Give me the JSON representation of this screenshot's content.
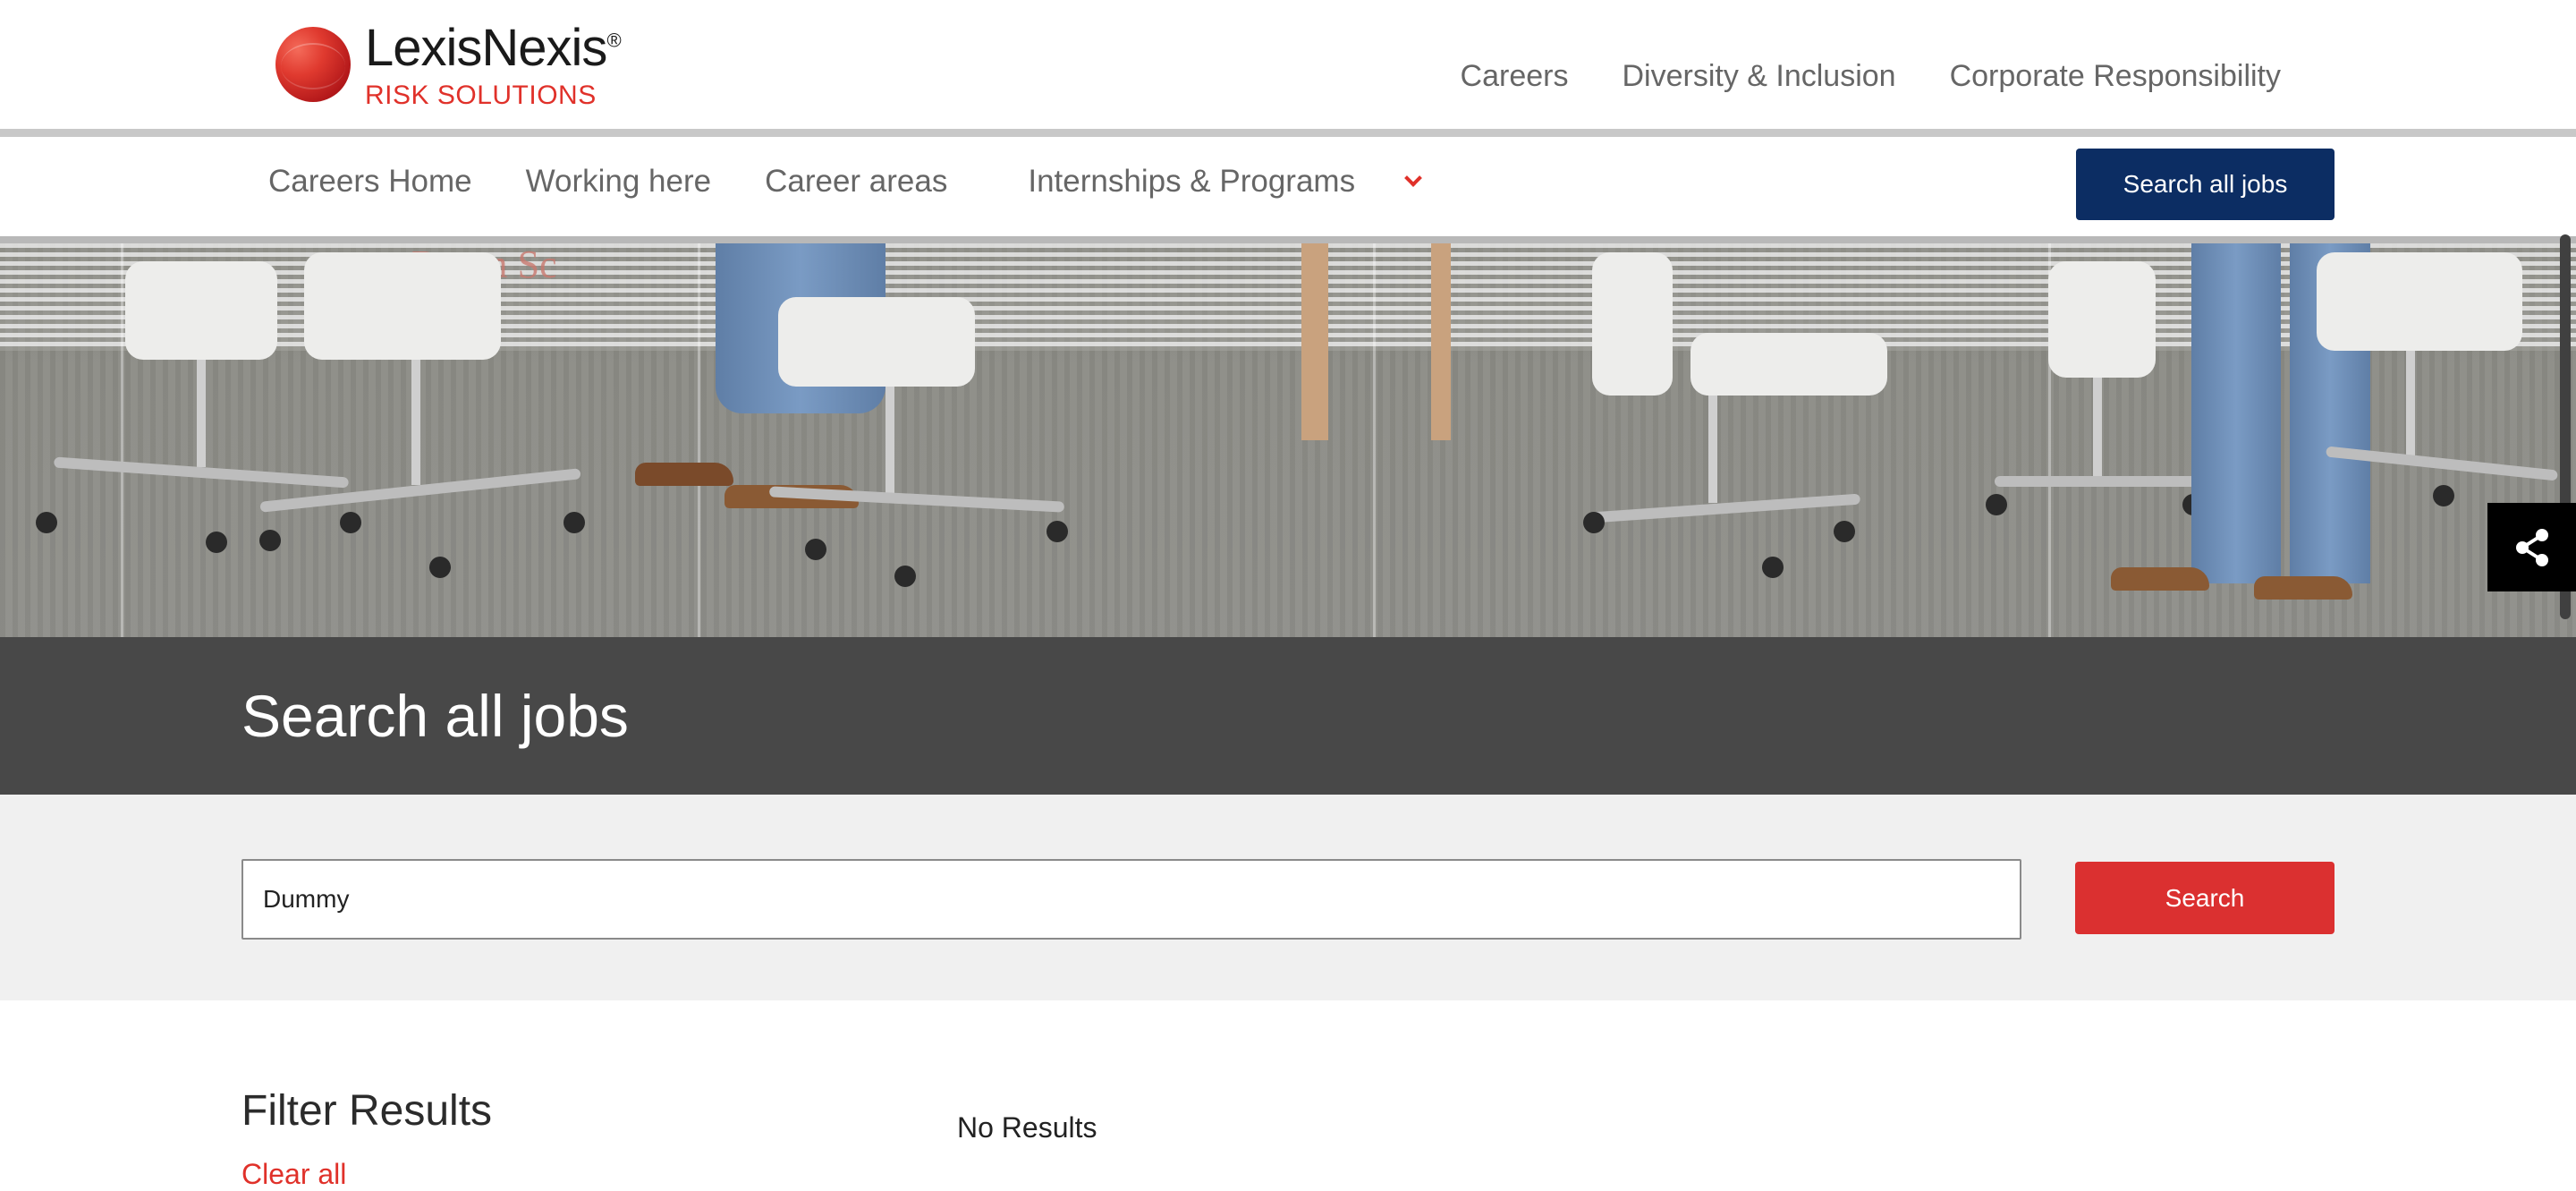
{
  "brand": {
    "name": "LexisNexis",
    "trademark": "®",
    "tagline": "RISK SOLUTIONS"
  },
  "top_nav": {
    "items": [
      "Careers",
      "Diversity & Inclusion",
      "Corporate Responsibility"
    ]
  },
  "sub_nav": {
    "items": [
      "Careers Home",
      "Working here",
      "Career areas",
      "Internships & Programs"
    ],
    "search_all_jobs_label": "Search all jobs"
  },
  "hero": {
    "background_text": "Room Sc"
  },
  "page": {
    "title": "Search all jobs"
  },
  "search": {
    "value": "Dummy",
    "button_label": "Search"
  },
  "filters": {
    "title": "Filter Results",
    "clear_all": "Clear all"
  },
  "results": {
    "status": "No Results"
  },
  "share": {
    "icon": "share-icon"
  },
  "colors": {
    "brand_red": "#e0312a",
    "navy": "#0c2d63",
    "title_band": "#484848",
    "search_band": "#f0f0f0",
    "search_button": "#db3030"
  }
}
